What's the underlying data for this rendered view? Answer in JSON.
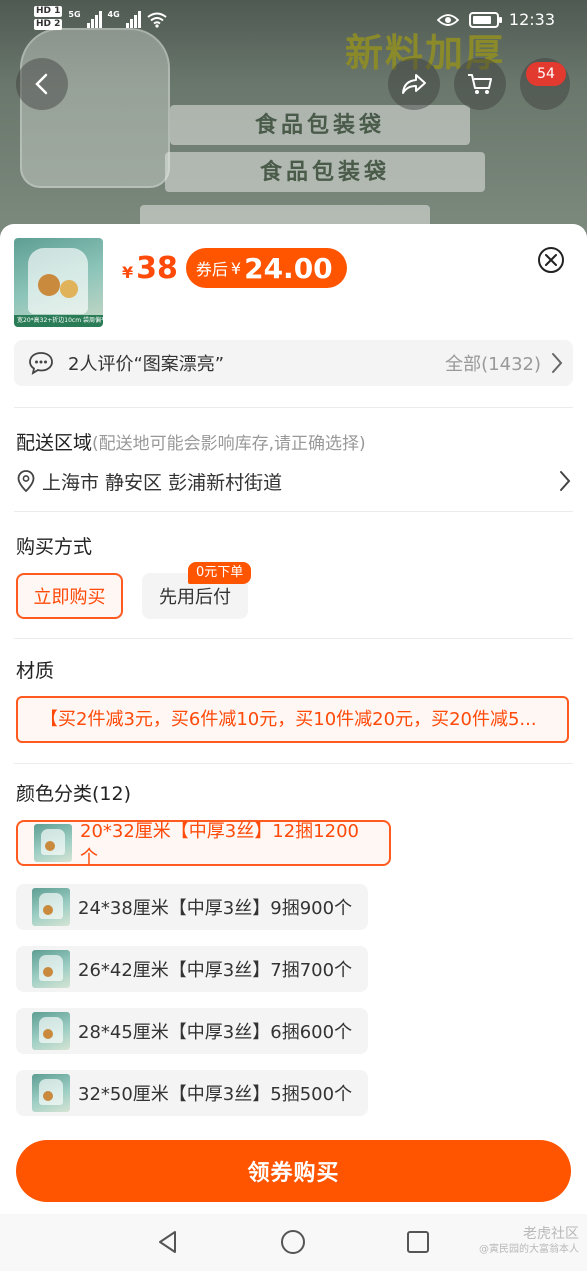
{
  "status_bar": {
    "hd1": "HD 1",
    "hd2": "HD 2",
    "net1": "5G",
    "net2": "4G",
    "time": "12:33"
  },
  "hero": {
    "title": "新料加厚",
    "strip_text": "食品包装袋"
  },
  "header": {
    "cart_badge": "54"
  },
  "product": {
    "thumb_caption": "宽20*高32+折边10cm 袋周偏平袋",
    "price_currency": "¥",
    "price": "38",
    "coupon_label": "券后",
    "coupon_currency": "¥",
    "coupon_price": "24.00"
  },
  "reviews": {
    "text": "2人评价“图案漂亮”",
    "all_label": "全部(1432)"
  },
  "delivery": {
    "title": "配送区域",
    "hint": "(配送地可能会影响库存,请正确选择)",
    "address": "上海市 静安区 彭浦新村街道"
  },
  "purchase": {
    "title": "购买方式",
    "options": [
      "立即购买",
      "先用后付"
    ],
    "badge": "0元下单"
  },
  "material": {
    "title": "材质",
    "value": "【买2件减3元，买6件减10元，买10件减20元，买20件减5..."
  },
  "colors": {
    "title": "颜色分类(12)",
    "items": [
      "20*32厘米【中厚3丝】12捆1200个",
      "24*38厘米【中厚3丝】9捆900个",
      "26*42厘米【中厚3丝】7捆700个",
      "28*45厘米【中厚3丝】6捆600个",
      "32*50厘米【中厚3丝】5捆500个"
    ]
  },
  "cta": {
    "label": "领券购买"
  },
  "watermark": {
    "line1": "老虎社区",
    "line2": "@寅民园的大富翁本人"
  },
  "colors_theme": {
    "accent": "#ff5500",
    "price": "#ff4a0a",
    "panel_bg": "#f4f4f4"
  }
}
